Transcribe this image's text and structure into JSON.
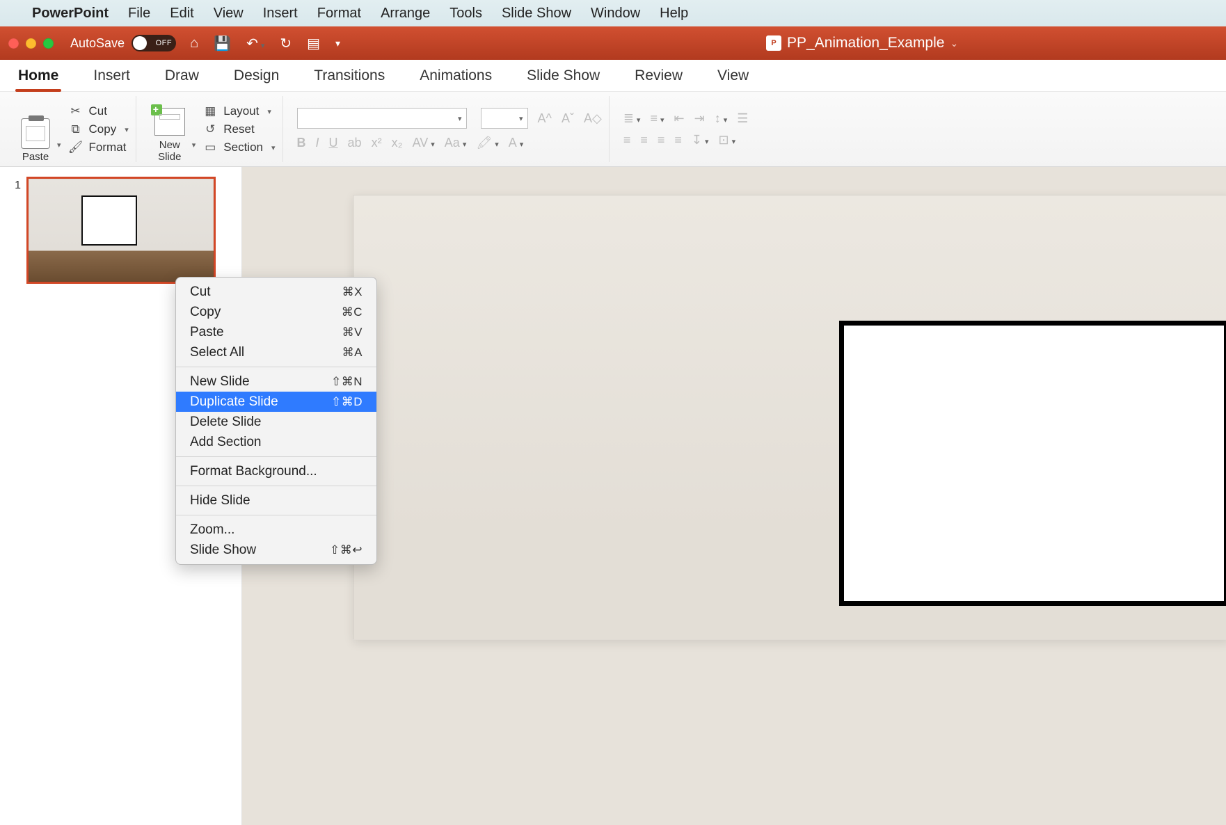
{
  "mac_menu": {
    "app": "PowerPoint",
    "items": [
      "File",
      "Edit",
      "View",
      "Insert",
      "Format",
      "Arrange",
      "Tools",
      "Slide Show",
      "Window",
      "Help"
    ]
  },
  "titlebar": {
    "autosave_label": "AutoSave",
    "autosave_state": "OFF",
    "filename": "PP_Animation_Example",
    "pp_badge": "P"
  },
  "ribbon_tabs": [
    "Home",
    "Insert",
    "Draw",
    "Design",
    "Transitions",
    "Animations",
    "Slide Show",
    "Review",
    "View"
  ],
  "ribbon_active": "Home",
  "ribbon": {
    "paste": "Paste",
    "cut": "Cut",
    "copy": "Copy",
    "format": "Format",
    "new_slide": "New\nSlide",
    "layout": "Layout",
    "reset": "Reset",
    "section": "Section"
  },
  "slide_panel": {
    "current_index": "1"
  },
  "context_menu": {
    "items": [
      {
        "label": "Cut",
        "shortcut": "⌘X"
      },
      {
        "label": "Copy",
        "shortcut": "⌘C"
      },
      {
        "label": "Paste",
        "shortcut": "⌘V"
      },
      {
        "label": "Select All",
        "shortcut": "⌘A"
      },
      {
        "sep": true
      },
      {
        "label": "New Slide",
        "shortcut": "⇧⌘N"
      },
      {
        "label": "Duplicate Slide",
        "shortcut": "⇧⌘D",
        "highlight": true
      },
      {
        "label": "Delete Slide",
        "shortcut": ""
      },
      {
        "label": "Add Section",
        "shortcut": ""
      },
      {
        "sep": true
      },
      {
        "label": "Format Background...",
        "shortcut": ""
      },
      {
        "sep": true
      },
      {
        "label": "Hide Slide",
        "shortcut": ""
      },
      {
        "sep": true
      },
      {
        "label": "Zoom...",
        "shortcut": ""
      },
      {
        "label": "Slide Show",
        "shortcut": "⇧⌘↩"
      }
    ]
  }
}
